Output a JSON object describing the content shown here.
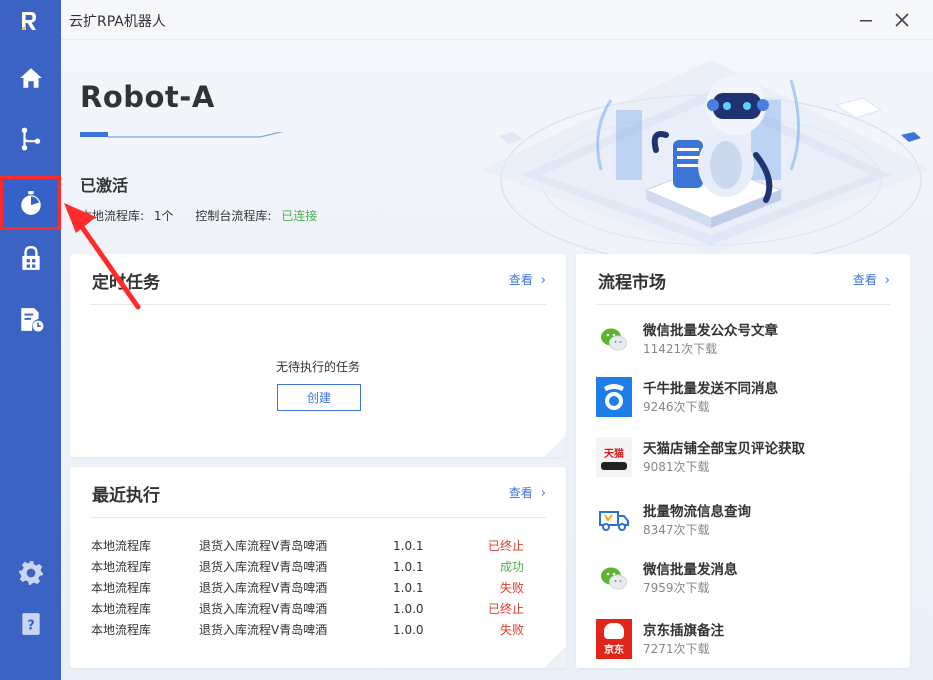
{
  "window": {
    "title": "云扩RPA机器人"
  },
  "sidebar": {
    "items": [
      {
        "icon": "home-icon"
      },
      {
        "icon": "flow-icon"
      },
      {
        "icon": "timer-icon",
        "active": true
      },
      {
        "icon": "lock-icon"
      },
      {
        "icon": "file-clock-icon"
      }
    ],
    "bottom": [
      {
        "icon": "gear-icon"
      },
      {
        "icon": "help-book-icon"
      }
    ]
  },
  "hero": {
    "name": "Robot-A",
    "status": "已激活",
    "local_label": "本地流程库:",
    "local_count": "1个",
    "console_label": "控制台流程库:",
    "console_status": "已连接"
  },
  "scheduled": {
    "title": "定时任务",
    "more": "查看",
    "empty": "无待执行的任务",
    "create": "创建"
  },
  "recent": {
    "title": "最近执行",
    "more": "查看",
    "rows": [
      {
        "lib": "本地流程库",
        "name": "退货入库流程V青岛啤酒",
        "version": "1.0.1",
        "status": "已终止",
        "kind": "stop"
      },
      {
        "lib": "本地流程库",
        "name": "退货入库流程V青岛啤酒",
        "version": "1.0.1",
        "status": "成功",
        "kind": "ok"
      },
      {
        "lib": "本地流程库",
        "name": "退货入库流程V青岛啤酒",
        "version": "1.0.1",
        "status": "失败",
        "kind": "fail"
      },
      {
        "lib": "本地流程库",
        "name": "退货入库流程V青岛啤酒",
        "version": "1.0.0",
        "status": "已终止",
        "kind": "stop"
      },
      {
        "lib": "本地流程库",
        "name": "退货入库流程V青岛啤酒",
        "version": "1.0.0",
        "status": "失败",
        "kind": "fail"
      }
    ]
  },
  "market": {
    "title": "流程市场",
    "more": "查看",
    "items": [
      {
        "name": "微信批量发公众号文章",
        "downloads": "11421次下载",
        "icon": "wechat-icon"
      },
      {
        "name": "千牛批量发送不同消息",
        "downloads": "9246次下载",
        "icon": "qianniu-icon"
      },
      {
        "name": "天猫店铺全部宝贝评论获取",
        "downloads": "9081次下载",
        "icon": "tmall-icon",
        "icon_text": "天猫"
      },
      {
        "name": "批量物流信息查询",
        "downloads": "8347次下载",
        "icon": "truck-icon"
      },
      {
        "name": "微信批量发消息",
        "downloads": "7959次下载",
        "icon": "wechat-icon"
      },
      {
        "name": "京东插旗备注",
        "downloads": "7271次下载",
        "icon": "jd-icon",
        "icon_text": "京东"
      }
    ]
  },
  "colors": {
    "sidebar": "#3b63c4",
    "accent": "#3d74d8",
    "success": "#4caf50",
    "danger": "#e0392b",
    "highlight": "#ff2a2a"
  }
}
